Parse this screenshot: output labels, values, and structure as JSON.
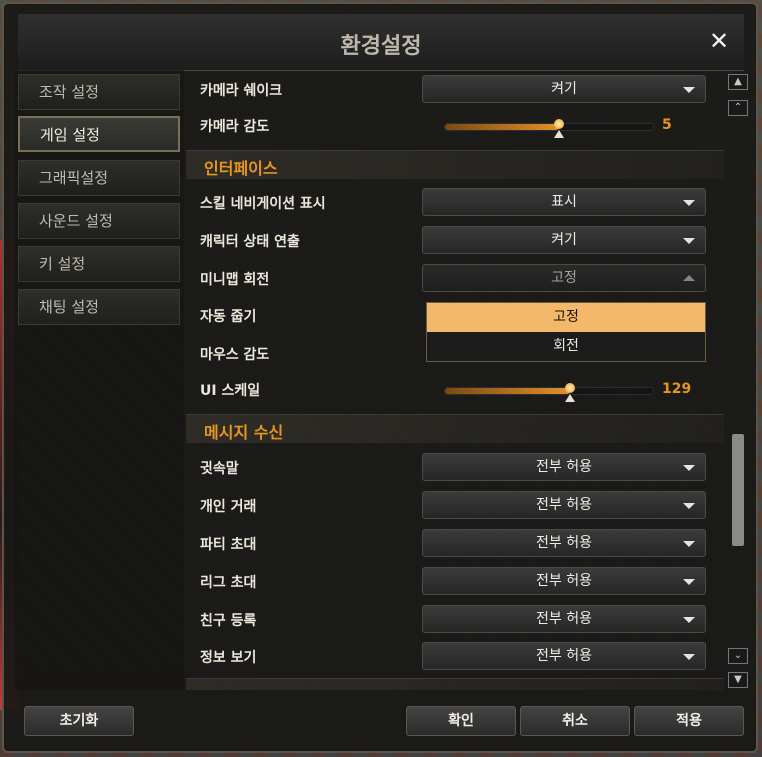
{
  "window": {
    "title": "환경설정",
    "close_glyph": "✕"
  },
  "sidebar": {
    "tabs": [
      {
        "label": "조작 설정",
        "active": false
      },
      {
        "label": "게임 설정",
        "active": true
      },
      {
        "label": "그래픽설정",
        "active": false
      },
      {
        "label": "사운드 설정",
        "active": false
      },
      {
        "label": "키 설정",
        "active": false
      },
      {
        "label": "채팅 설정",
        "active": false
      }
    ]
  },
  "settings": {
    "camera_shake": {
      "label": "카메라 쉐이크",
      "value": "켜기"
    },
    "camera_sensitivity": {
      "label": "카메라 감도",
      "value": "5",
      "level_fraction": 0.55
    },
    "section_interface": "인터페이스",
    "skill_nav": {
      "label": "스킬 네비게이션 표시",
      "value": "표시"
    },
    "char_status": {
      "label": "캐릭터 상태 연출",
      "value": "켜기"
    },
    "minimap_rotate": {
      "label": "미니맵 회전",
      "value": "고정"
    },
    "auto_pickup": {
      "label": "자동 줍기"
    },
    "mouse_sensitivity": {
      "label": "마우스 감도"
    },
    "ui_scale": {
      "label": "UI 스케일",
      "value": "129",
      "level_fraction": 0.6
    },
    "section_message": "메시지 수신",
    "whisper": {
      "label": "귓속말",
      "value": "전부 허용"
    },
    "trade": {
      "label": "개인 거래",
      "value": "전부 허용"
    },
    "party": {
      "label": "파티 초대",
      "value": "전부 허용"
    },
    "league": {
      "label": "리그 초대",
      "value": "전부 허용"
    },
    "friend": {
      "label": "친구 등록",
      "value": "전부 허용"
    },
    "info": {
      "label": "정보 보기",
      "value": "전부 허용"
    }
  },
  "minimap_popup": {
    "options": [
      "고정",
      "회전"
    ],
    "selected": "고정"
  },
  "footer": {
    "reset": "초기화",
    "confirm": "확인",
    "cancel": "취소",
    "apply": "적용"
  },
  "colors": {
    "accent": "#e8951e",
    "popup_selected": "#f3b86a"
  },
  "icons": {
    "close": "close-icon",
    "dropdown": "chevron-down-icon",
    "scroll_top": "scroll-top-icon",
    "scroll_up": "scroll-up-icon",
    "scroll_down": "scroll-down-icon",
    "scroll_bottom": "scroll-bottom-icon"
  }
}
